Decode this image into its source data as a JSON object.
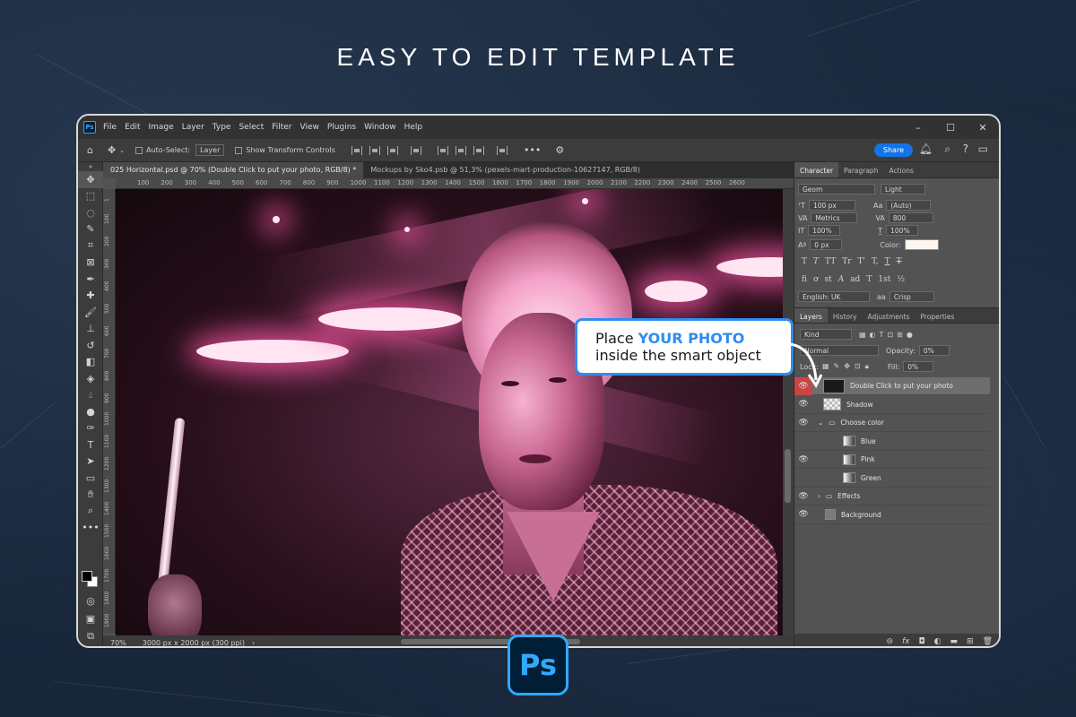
{
  "headline": "EASY TO EDIT TEMPLATE",
  "app": {
    "logo_text": "Ps",
    "menu": [
      "File",
      "Edit",
      "Image",
      "Layer",
      "Type",
      "Select",
      "Filter",
      "View",
      "Plugins",
      "Window",
      "Help"
    ],
    "window_controls": [
      "–",
      "☐",
      "✕"
    ]
  },
  "options_bar": {
    "auto_select_label": "Auto-Select:",
    "auto_select_value": "Layer",
    "show_transform_label": "Show Transform Controls",
    "share_label": "Share"
  },
  "tabs": [
    {
      "label": "025 Horizontal.psd @ 70% (Double Click to put your photo, RGB/8) *",
      "active": true
    },
    {
      "label": "Mockups by Sko4.psb @ 51,3% (pexels-mart-production-10627147, RGB/8)",
      "active": false
    }
  ],
  "rulers": {
    "top": [
      "100",
      "200",
      "300",
      "400",
      "500",
      "600",
      "700",
      "800",
      "900",
      "1000",
      "1100",
      "1200",
      "1300",
      "1400",
      "1500",
      "1600",
      "1700",
      "1800",
      "1900",
      "2000",
      "2100",
      "2200",
      "2300",
      "2400",
      "2500",
      "2600"
    ],
    "left": [
      "1",
      "100",
      "200",
      "300",
      "400",
      "500",
      "600",
      "700",
      "800",
      "900",
      "1000",
      "1100",
      "1200",
      "1300",
      "1400",
      "1500",
      "1600",
      "1700",
      "1800",
      "1900"
    ]
  },
  "status": {
    "zoom": "70%",
    "doc_info": "3000 px x 2000 px (300 ppi)"
  },
  "character_panel": {
    "tabs": [
      "Character",
      "Paragraph",
      "Actions"
    ],
    "font_family": "Geom",
    "font_style": "Light",
    "font_size": "100 px",
    "leading": "(Auto)",
    "kerning": "Metrics",
    "tracking": "800",
    "vertical_scale": "100%",
    "horizontal_scale": "100%",
    "baseline": "0 px",
    "color_label": "Color:",
    "color_value": "#fff6f0",
    "typo_buttons": [
      "T",
      "T",
      "TT",
      "Tr",
      "T'",
      "T,",
      "T",
      "T"
    ],
    "ot_buttons": [
      "fi",
      "ơ",
      "st",
      "A",
      "ad",
      "T",
      "1st",
      "½"
    ],
    "language": "English: UK",
    "antialias": "Crisp"
  },
  "layers_panel": {
    "tabs": [
      "Layers",
      "History",
      "Adjustments",
      "Properties"
    ],
    "filter_kind": "Kind",
    "blend_mode": "Normal",
    "opacity_label": "Opacity:",
    "opacity": "0%",
    "lock_label": "Lock:",
    "fill_label": "Fill:",
    "fill": "0%",
    "layers": [
      {
        "name": "Double Click to put your photo",
        "visible": true,
        "selected": true,
        "indent": 0,
        "kind": "smart"
      },
      {
        "name": "Shadow",
        "visible": true,
        "selected": false,
        "indent": 0,
        "kind": "checker"
      },
      {
        "name": "Choose color",
        "visible": true,
        "selected": false,
        "indent": 0,
        "kind": "group"
      },
      {
        "name": "Blue",
        "visible": false,
        "selected": false,
        "indent": 1,
        "kind": "gradient"
      },
      {
        "name": "Pink",
        "visible": true,
        "selected": false,
        "indent": 1,
        "kind": "gradient"
      },
      {
        "name": "Green",
        "visible": false,
        "selected": false,
        "indent": 1,
        "kind": "gradient"
      },
      {
        "name": "Effects",
        "visible": true,
        "selected": false,
        "indent": 0,
        "kind": "group-closed"
      },
      {
        "name": "Background",
        "visible": true,
        "selected": false,
        "indent": 0,
        "kind": "fill"
      }
    ]
  },
  "callout": {
    "line1_prefix": "Place ",
    "line1_highlight": "YOUR PHOTO",
    "line2": "inside the smart object"
  },
  "colors": {
    "accent": "#2f8cf0",
    "ps_blue": "#31a8ff",
    "selected_eye": "#c94545"
  },
  "icons": [
    "home-icon",
    "move-icon",
    "gear-icon",
    "bell-icon",
    "search-icon",
    "help-icon",
    "eye-icon",
    "folder-icon",
    "lock-icon",
    "link-icon",
    "fx-icon",
    "trash-icon"
  ]
}
